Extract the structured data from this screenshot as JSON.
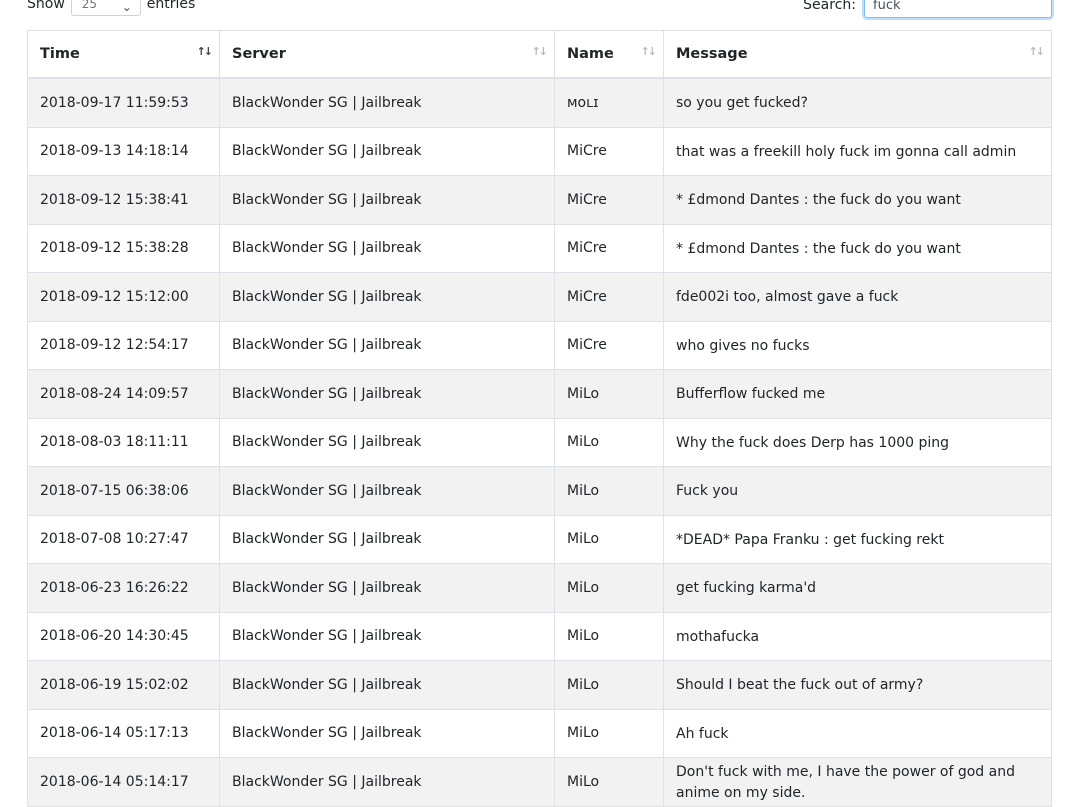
{
  "controls": {
    "show_label": "Show",
    "page_length": "25",
    "entries_label": "entries",
    "search_label": "Search:",
    "search_value": "fuck"
  },
  "table": {
    "columns": [
      {
        "label": "Time",
        "sort": "desc"
      },
      {
        "label": "Server",
        "sort": "none"
      },
      {
        "label": "Name",
        "sort": "none"
      },
      {
        "label": "Message",
        "sort": "none"
      }
    ],
    "rows": [
      {
        "time": "2018-09-17 11:59:53",
        "server": "BlackWonder SG | Jailbreak",
        "name": "ᴍᴏʟɪ",
        "message": "so you get fucked?"
      },
      {
        "time": "2018-09-13 14:18:14",
        "server": "BlackWonder SG | Jailbreak",
        "name": "MiCre",
        "message": "that was a freekill holy fuck im gonna call admin"
      },
      {
        "time": "2018-09-12 15:38:41",
        "server": "BlackWonder SG | Jailbreak",
        "name": "MiCre",
        "message": "* £dmond Dantes : the fuck do you want"
      },
      {
        "time": "2018-09-12 15:38:28",
        "server": "BlackWonder SG | Jailbreak",
        "name": "MiCre",
        "message": "* £dmond Dantes : the fuck do you want"
      },
      {
        "time": "2018-09-12 15:12:00",
        "server": "BlackWonder SG | Jailbreak",
        "name": "MiCre",
        "message": "fde002i too, almost gave a fuck"
      },
      {
        "time": "2018-09-12 12:54:17",
        "server": "BlackWonder SG | Jailbreak",
        "name": "MiCre",
        "message": "who gives no fucks"
      },
      {
        "time": "2018-08-24 14:09:57",
        "server": "BlackWonder SG | Jailbreak",
        "name": "MiLo",
        "message": "Bufferflow fucked me"
      },
      {
        "time": "2018-08-03 18:11:11",
        "server": "BlackWonder SG | Jailbreak",
        "name": "MiLo",
        "message": "Why the fuck does Derp has 1000 ping"
      },
      {
        "time": "2018-07-15 06:38:06",
        "server": "BlackWonder SG | Jailbreak",
        "name": "MiLo",
        "message": "Fuck you"
      },
      {
        "time": "2018-07-08 10:27:47",
        "server": "BlackWonder SG | Jailbreak",
        "name": "MiLo",
        "message": "*DEAD* Papa Franku : get fucking rekt"
      },
      {
        "time": "2018-06-23 16:26:22",
        "server": "BlackWonder SG | Jailbreak",
        "name": "MiLo",
        "message": "get fucking karma'd"
      },
      {
        "time": "2018-06-20 14:30:45",
        "server": "BlackWonder SG | Jailbreak",
        "name": "MiLo",
        "message": "mothafucka"
      },
      {
        "time": "2018-06-19 15:02:02",
        "server": "BlackWonder SG | Jailbreak",
        "name": "MiLo",
        "message": "Should I beat the fuck out of army?"
      },
      {
        "time": "2018-06-14 05:17:13",
        "server": "BlackWonder SG | Jailbreak",
        "name": "MiLo",
        "message": "Ah fuck"
      },
      {
        "time": "2018-06-14 05:14:17",
        "server": "BlackWonder SG | Jailbreak",
        "name": "MiLo",
        "message": "Don't fuck with me, I have the power of god and anime on my side."
      }
    ]
  }
}
